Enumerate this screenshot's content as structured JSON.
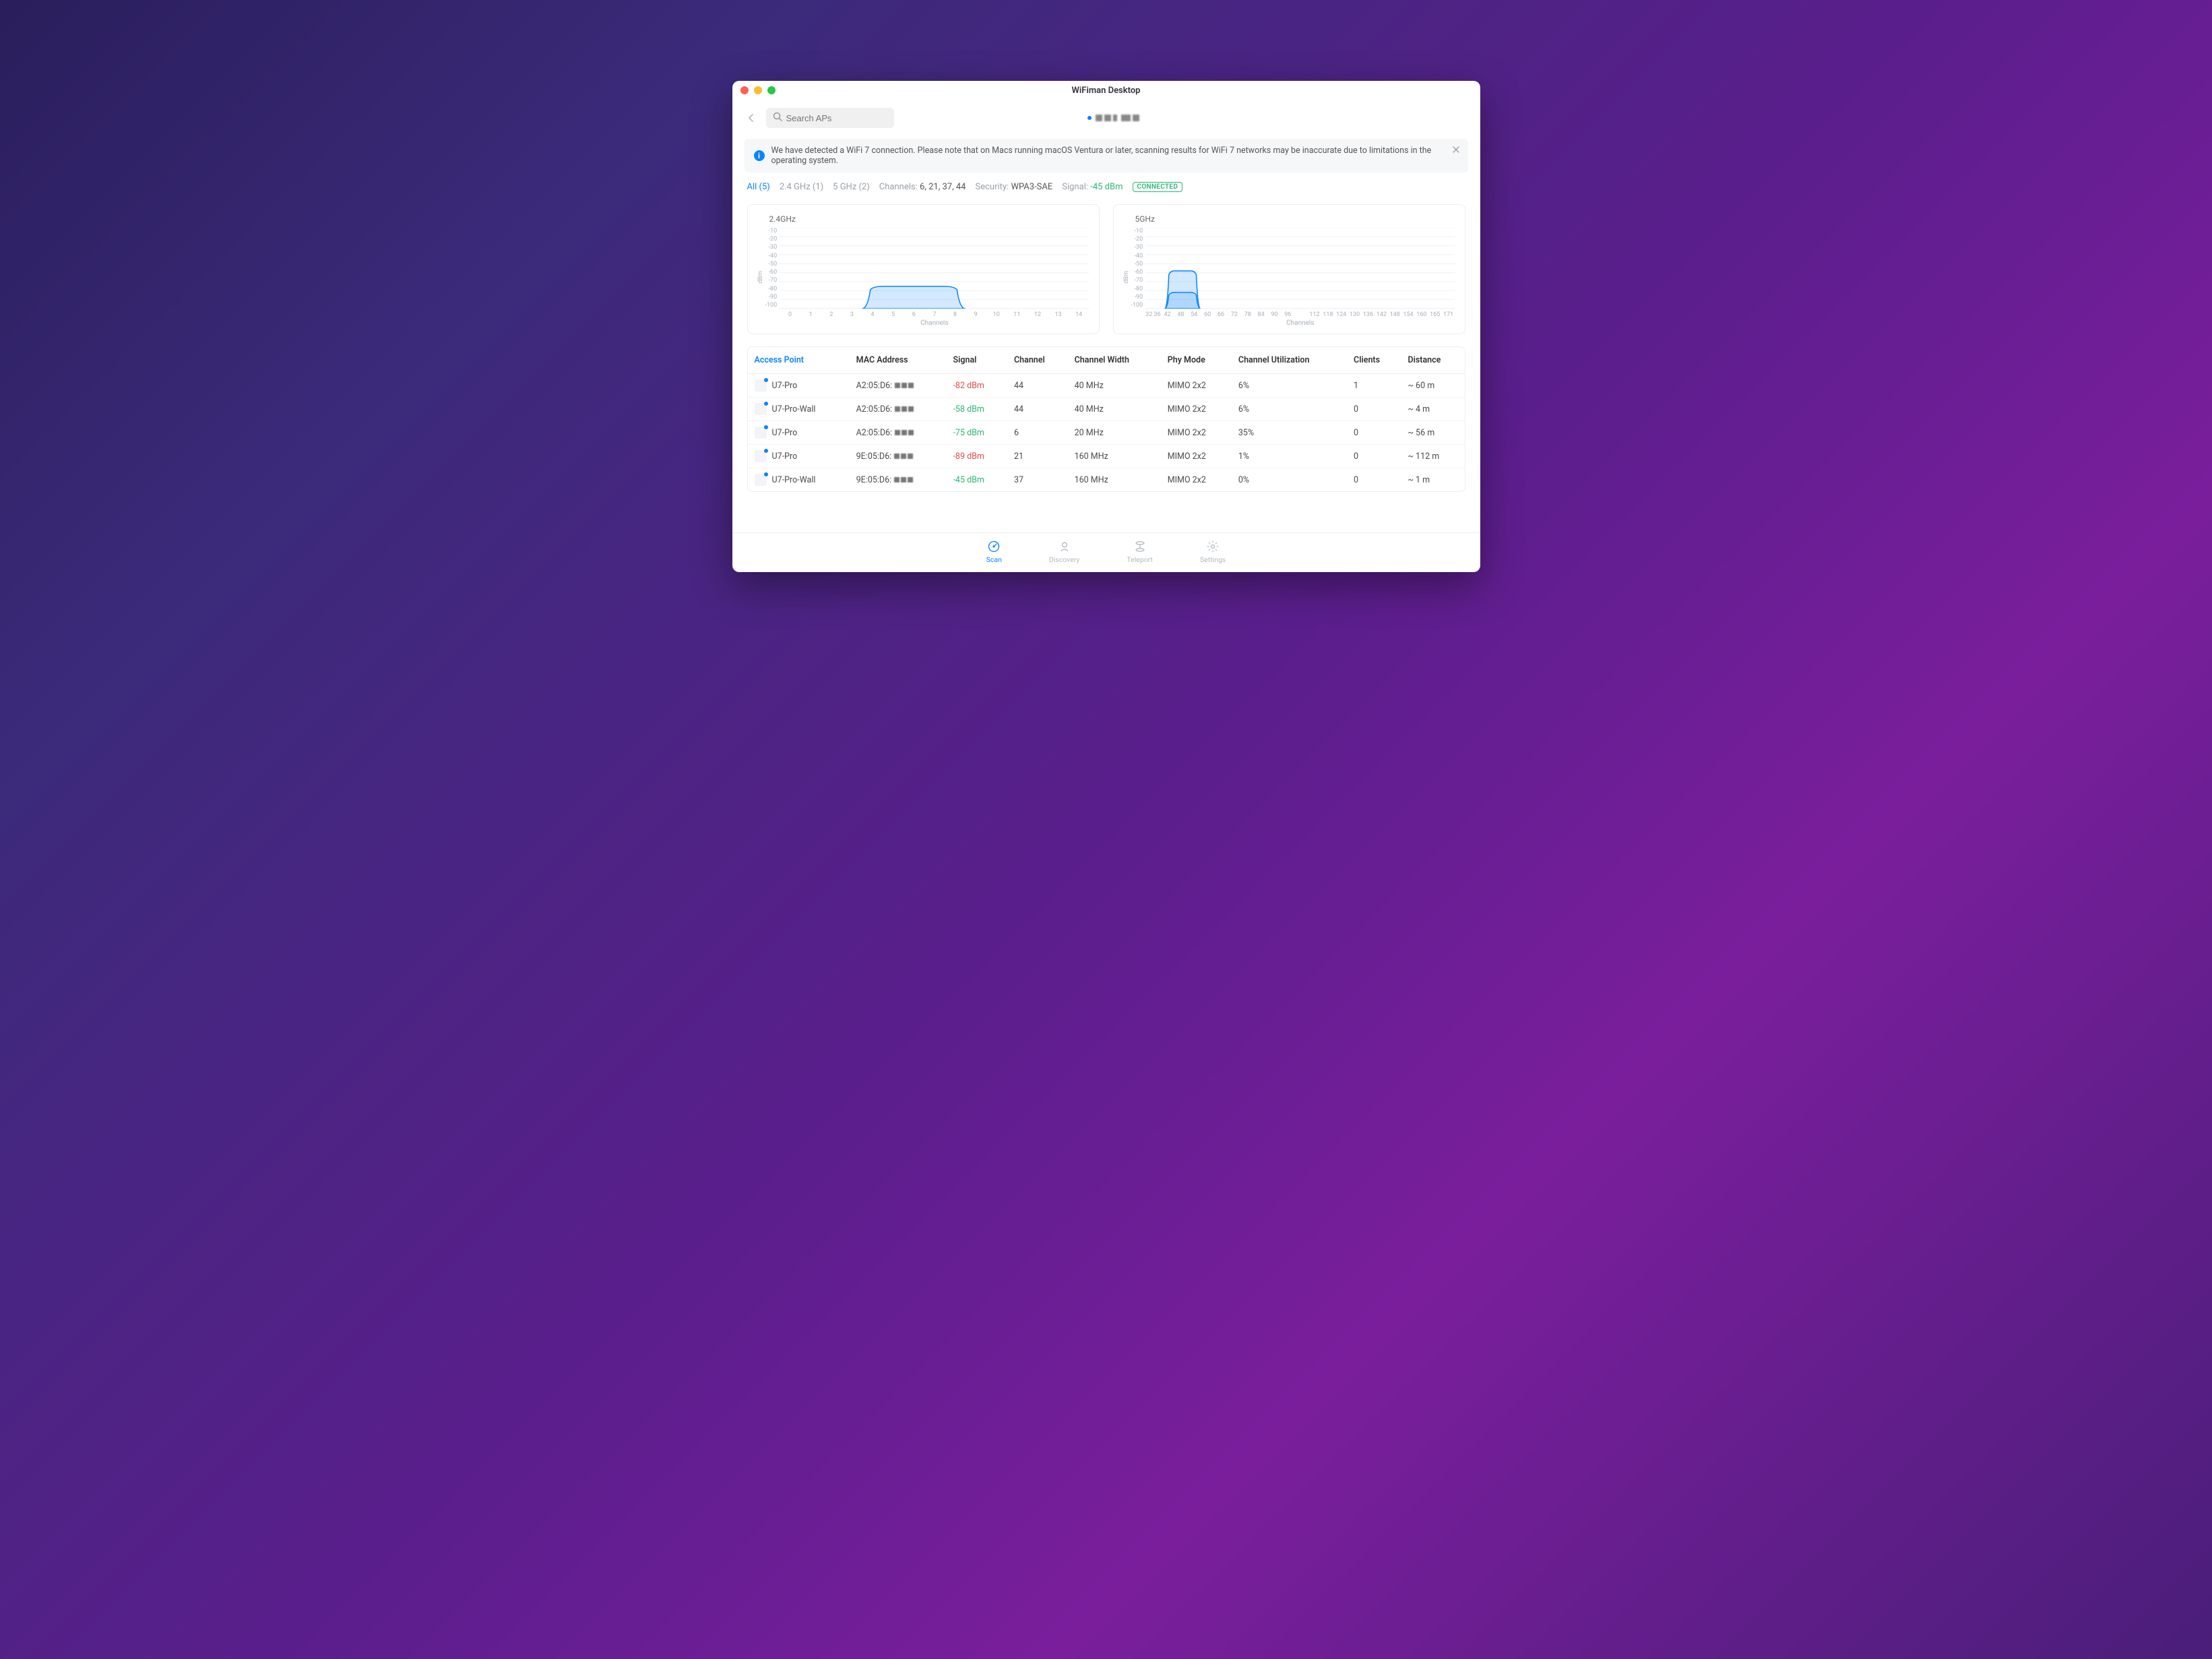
{
  "window": {
    "title": "WiFiman Desktop"
  },
  "search": {
    "placeholder": "Search APs"
  },
  "banner": {
    "text": "We have detected a WiFi 7 connection. Please note that on Macs running macOS Ventura or later, scanning results for WiFi 7 networks may be inaccurate due to limitations in the operating system."
  },
  "filters": {
    "all": "All (5)",
    "b24": "2.4 GHz (1)",
    "b5": "5 GHz (2)",
    "channels_label": "Channels:",
    "channels": "6, 21, 37, 44",
    "security_label": "Security:",
    "security": "WPA3-SAE",
    "signal_label": "Signal:",
    "signal": "-45 dBm",
    "connected": "CONNECTED"
  },
  "chart_data": [
    {
      "type": "area",
      "title": "2.4GHz",
      "xlabel": "Channels",
      "ylabel": "dBm",
      "ylim": [
        -100,
        -10
      ],
      "y_ticks": [
        -10,
        -20,
        -30,
        -40,
        -50,
        -60,
        -70,
        -80,
        -90,
        -100
      ],
      "x_ticks": [
        0,
        1,
        2,
        3,
        4,
        5,
        6,
        7,
        8,
        9,
        10,
        11,
        12,
        13,
        14
      ],
      "series": [
        {
          "name": "U7-Pro",
          "center_channel": 6,
          "width_channels": 4,
          "signal_dbm": -75
        }
      ]
    },
    {
      "type": "area",
      "title": "5GHz",
      "xlabel": "Channels",
      "ylabel": "dBm",
      "ylim": [
        -100,
        -10
      ],
      "y_ticks": [
        -10,
        -20,
        -30,
        -40,
        -50,
        -60,
        -70,
        -80,
        -90,
        -100
      ],
      "x_ticks": [
        "32 36",
        42,
        48,
        54,
        60,
        66,
        72,
        78,
        84,
        90,
        96,
        "",
        112,
        118,
        124,
        130,
        136,
        142,
        148,
        154,
        160,
        165,
        171
      ],
      "series": [
        {
          "name": "U7-Pro",
          "center_channel": 44,
          "width_channels": 8,
          "signal_dbm": -82
        },
        {
          "name": "U7-Pro-Wall",
          "center_channel": 44,
          "width_channels": 8,
          "signal_dbm": -58
        }
      ]
    }
  ],
  "table": {
    "columns": [
      "Access Point",
      "MAC Address",
      "Signal",
      "Channel",
      "Channel Width",
      "Phy Mode",
      "Channel Utilization",
      "Clients",
      "Distance"
    ],
    "rows": [
      {
        "ap": "U7-Pro",
        "mac_prefix": "A2:05:D6:",
        "signal": "-82 dBm",
        "signal_class": "sig-red",
        "channel": "44",
        "width": "40 MHz",
        "phy": "MIMO 2x2",
        "util": "6%",
        "clients": "1",
        "distance": "~ 60 m"
      },
      {
        "ap": "U7-Pro-Wall",
        "mac_prefix": "A2:05:D6:",
        "signal": "-58 dBm",
        "signal_class": "sig-green",
        "channel": "44",
        "width": "40 MHz",
        "phy": "MIMO 2x2",
        "util": "6%",
        "clients": "0",
        "distance": "~ 4 m"
      },
      {
        "ap": "U7-Pro",
        "mac_prefix": "A2:05:D6:",
        "signal": "-75 dBm",
        "signal_class": "sig-green",
        "channel": "6",
        "width": "20 MHz",
        "phy": "MIMO 2x2",
        "util": "35%",
        "clients": "0",
        "distance": "~ 56 m"
      },
      {
        "ap": "U7-Pro",
        "mac_prefix": "9E:05:D6:",
        "signal": "-89 dBm",
        "signal_class": "sig-red",
        "channel": "21",
        "width": "160 MHz",
        "phy": "MIMO 2x2",
        "util": "1%",
        "clients": "0",
        "distance": "~ 112 m"
      },
      {
        "ap": "U7-Pro-Wall",
        "mac_prefix": "9E:05:D6:",
        "signal": "-45 dBm",
        "signal_class": "sig-green",
        "channel": "37",
        "width": "160 MHz",
        "phy": "MIMO 2x2",
        "util": "0%",
        "clients": "0",
        "distance": "~ 1 m"
      }
    ]
  },
  "nav": {
    "scan": "Scan",
    "discovery": "Discovery",
    "teleport": "Teleport",
    "settings": "Settings"
  }
}
